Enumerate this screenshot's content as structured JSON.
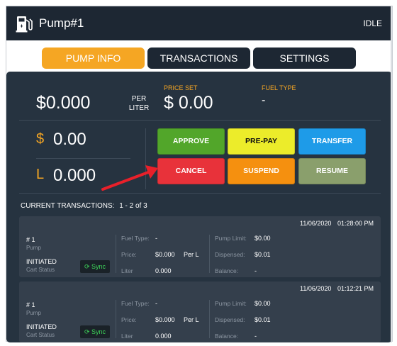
{
  "header": {
    "title": "Pump#1",
    "status": "IDLE"
  },
  "tabs": {
    "pump_info": "PUMP INFO",
    "transactions": "TRANSACTIONS",
    "settings": "SETTINGS"
  },
  "price": {
    "unit_price": "$0.000",
    "per_liter_line1": "PER",
    "per_liter_line2": "LITER",
    "price_set_label": "PRICE SET",
    "price_set_value": "$ 0.00",
    "fuel_type_label": "FUEL TYPE",
    "fuel_type_value": "-"
  },
  "amounts": {
    "money_prefix": "$",
    "money_value": "0.00",
    "liter_prefix": "L",
    "liter_value": "0.000"
  },
  "actions": {
    "approve": "APPROVE",
    "prepay": "PRE-PAY",
    "transfer": "TRANSFER",
    "cancel": "CANCEL",
    "suspend": "SUSPEND",
    "resume": "RESUME"
  },
  "current_transactions": {
    "label": "CURRENT TRANSACTIONS:",
    "range": "1 - 2 of 3"
  },
  "transactions": [
    {
      "date": "11/06/2020",
      "time": "01:28:00 PM",
      "number": "# 1",
      "number_sub": "Pump",
      "state": "INITIATED",
      "state_sub": "Cart Status",
      "sync": "Sync",
      "fuel_type_label": "Fuel Type:",
      "fuel_type": "-",
      "price_label": "Price:",
      "price": "$0.000",
      "price_unit": "Per L",
      "liter_label": "Liter",
      "liter": "0.000",
      "pump_limit_label": "Pump Limit:",
      "pump_limit": "$0.00",
      "dispensed_label": "Dispensed:",
      "dispensed": "$0.01",
      "balance_label": "Balance:",
      "balance": "-"
    },
    {
      "date": "11/06/2020",
      "time": "01:12:21 PM",
      "number": "# 1",
      "number_sub": "Pump",
      "state": "INITIATED",
      "state_sub": "Cart Status",
      "sync": "Sync",
      "fuel_type_label": "Fuel Type:",
      "fuel_type": "-",
      "price_label": "Price:",
      "price": "$0.000",
      "price_unit": "Per L",
      "liter_label": "Liter",
      "liter": "0.000",
      "pump_limit_label": "Pump Limit:",
      "pump_limit": "$0.00",
      "dispensed_label": "Dispensed:",
      "dispensed": "$0.01",
      "balance_label": "Balance:",
      "balance": "-"
    }
  ],
  "icons": {
    "header": "fuel-pump-icon",
    "sync": "refresh-icon",
    "annotation": "red-arrow"
  },
  "colors": {
    "accent": "#f5a623",
    "header_bg": "#1d2733",
    "panel_bg": "#263340",
    "card_bg": "#343f4c",
    "sync_green": "#3ed65a"
  }
}
